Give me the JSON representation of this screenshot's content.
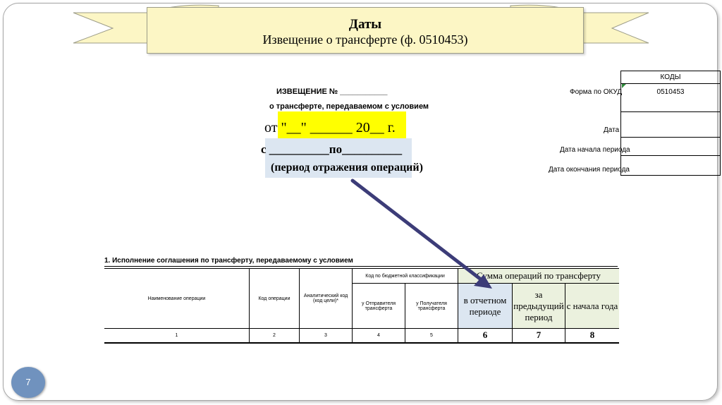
{
  "slide": {
    "title": "Даты",
    "subtitle": "Извещение о трансферте (ф. 0510453)",
    "page_number": "7"
  },
  "notice": {
    "header": "ИЗВЕЩЕНИЕ № ___________",
    "line2": "о трансферте, передаваемом с условием",
    "date_line": "от \"__\" ______ 20__ г.",
    "period_line": "с __________по__________",
    "period_caption": "(период отражения операций)"
  },
  "codes": {
    "header": "КОДЫ",
    "rows": [
      {
        "label": "Форма по ОКУД",
        "value": "0510453"
      },
      {
        "label": "Дата",
        "value": ""
      },
      {
        "label": "Дата начала периода",
        "value": ""
      },
      {
        "label": "Дата окончания периода",
        "value": ""
      }
    ]
  },
  "table": {
    "section_title": "1. Исполнение соглашения по трансферту, передаваемому с условием",
    "col_name": "Наименование операции",
    "col_code": "Код операции",
    "col_analytic": "Аналитический код (код цели)*",
    "col_budget_group": "Код по бюджетной классификации",
    "col_sender": "у Отправителя трансферта",
    "col_receiver": "у Получателя трансферта",
    "col_sum_group": "Сумма операций по трансферту",
    "col_current": "в отчетном периоде",
    "col_previous": "за предыдущий период",
    "col_year": "с начала года",
    "col_numbers": [
      "1",
      "2",
      "3",
      "4",
      "5",
      "6",
      "7",
      "8"
    ]
  },
  "colors": {
    "banner": "#fcf6c5",
    "highlight_yellow": "#ffff00",
    "highlight_blue": "#dce6f1",
    "header_green": "#ebf1de",
    "arrow": "#3c3c78",
    "page_badge": "#7092be"
  }
}
